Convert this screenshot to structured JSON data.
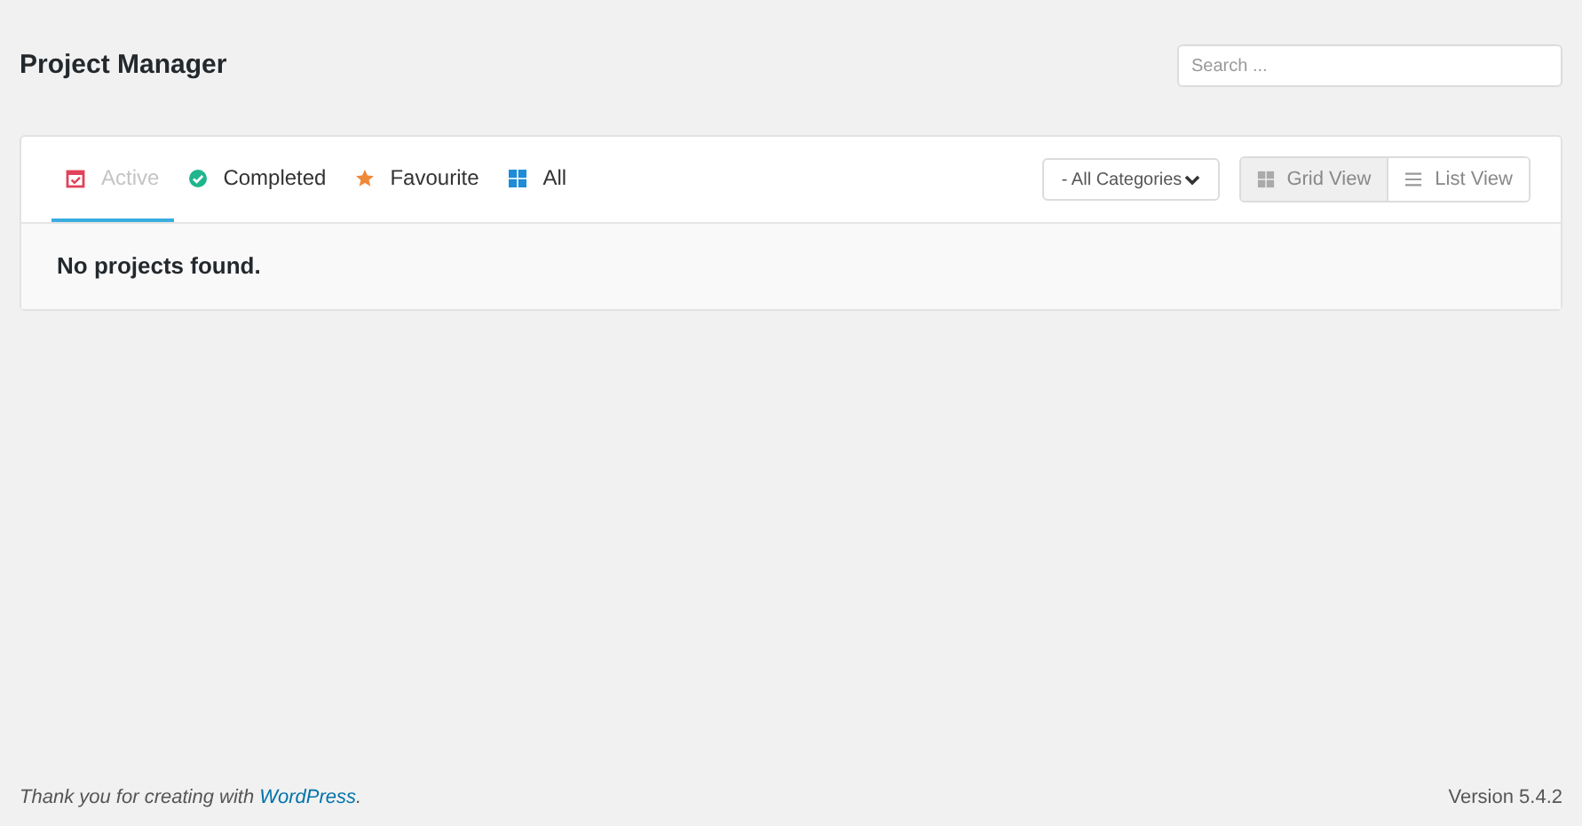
{
  "page_title": "Project Manager",
  "search": {
    "placeholder": "Search ..."
  },
  "tabs": [
    {
      "label": "Active",
      "selected": true
    },
    {
      "label": "Completed",
      "selected": false
    },
    {
      "label": "Favourite",
      "selected": false
    },
    {
      "label": "All",
      "selected": false
    }
  ],
  "category_select": {
    "value": "- All Categories"
  },
  "views": [
    {
      "label": "Grid View",
      "selected": true
    },
    {
      "label": "List View",
      "selected": false
    }
  ],
  "empty_message": "No projects found.",
  "footer": {
    "text": "Thank you for creating with ",
    "link": "WordPress",
    "text_end": ".",
    "version": "Version 5.4.2"
  }
}
